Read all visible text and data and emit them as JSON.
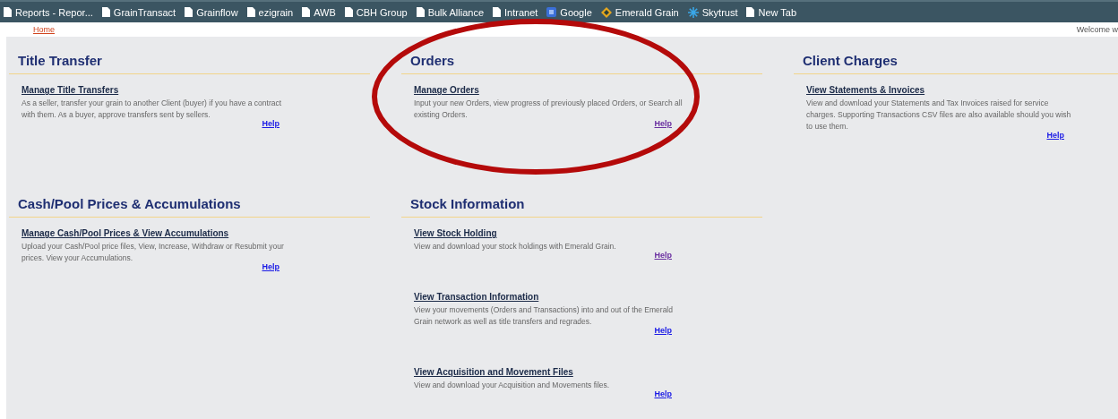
{
  "bookmarks": [
    {
      "label": "Reports - Repor...",
      "kind": "page"
    },
    {
      "label": "GrainTransact",
      "kind": "page"
    },
    {
      "label": "Grainflow",
      "kind": "page"
    },
    {
      "label": "ezigrain",
      "kind": "page"
    },
    {
      "label": "AWB",
      "kind": "page"
    },
    {
      "label": "CBH Group",
      "kind": "page"
    },
    {
      "label": "Bulk Alliance",
      "kind": "page"
    },
    {
      "label": "Intranet",
      "kind": "page"
    },
    {
      "label": "Google",
      "kind": "square"
    },
    {
      "label": "Emerald Grain",
      "kind": "diamond"
    },
    {
      "label": "Skytrust",
      "kind": "snowflake"
    },
    {
      "label": "New Tab",
      "kind": "page"
    }
  ],
  "nav": {
    "home": "Home",
    "welcome": "Welcome w"
  },
  "rows": [
    {
      "sections": [
        {
          "title": "Title Transfer",
          "circled": false,
          "items": [
            {
              "title": "Manage Title Transfers",
              "description": "As a seller, transfer your grain to another Client (buyer) if you have a contract with them. As a buyer, approve transfers sent by sellers.",
              "help": "Help",
              "visited": false
            }
          ]
        },
        {
          "title": "Orders",
          "circled": true,
          "items": [
            {
              "title": "Manage Orders",
              "description": "Input your new Orders, view progress of previously placed Orders, or Search all existing Orders.",
              "help": "Help",
              "visited": true
            }
          ]
        },
        {
          "title": "Client Charges",
          "circled": false,
          "items": [
            {
              "title": "View Statements & Invoices",
              "description": "View and download your Statements and Tax Invoices raised for service charges. Supporting Transactions CSV files are also available should you wish to use them.",
              "help": "Help",
              "visited": false
            }
          ]
        }
      ]
    },
    {
      "sections": [
        {
          "title": "Cash/Pool Prices & Accumulations",
          "circled": false,
          "items": [
            {
              "title": "Manage Cash/Pool Prices & View Accumulations",
              "description": "Upload your Cash/Pool price files, View, Increase, Withdraw or Resubmit your prices. View your Accumulations.",
              "help": "Help",
              "visited": false
            }
          ]
        },
        {
          "title": "Stock Information",
          "circled": false,
          "items": [
            {
              "title": "View Stock Holding",
              "description": "View and download your stock holdings with Emerald Grain.",
              "help": "Help",
              "visited": true
            },
            {
              "title": "View Transaction Information",
              "description": "View your movements (Orders and Transactions) into and out of the Emerald Grain network as well as title transfers and regrades.",
              "help": "Help",
              "visited": false
            },
            {
              "title": "View Acquisition and Movement Files",
              "description": "View and download your Acquisition and Movements files.",
              "help": "Help",
              "visited": false
            }
          ]
        }
      ]
    }
  ]
}
